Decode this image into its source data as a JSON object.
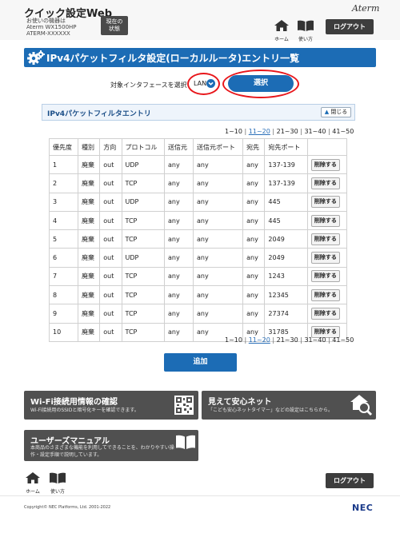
{
  "header": {
    "app_title": "クイック設定Web",
    "device_caption": "お使いの機器は",
    "device_model": "Aterm WX1500HP",
    "device_name": "ATERM-XXXXXX",
    "status_button_line1": "現在の",
    "status_button_line2": "状態",
    "brand": "Aterm",
    "home_label": "ホーム",
    "manual_label": "使い方",
    "logout_label": "ログアウト"
  },
  "page": {
    "title": "IPv4パケットフィルタ設定(ローカルルータ)エントリ一覧",
    "interface_label": "対象インタフェースを選択",
    "interface_value": "LAN",
    "select_button": "選択",
    "panel_title": "IPv4パケットフィルタエントリ",
    "collapse_label": "閉じる",
    "add_button": "追加"
  },
  "pager": {
    "pages": [
      "1~10",
      "11~20",
      "21~30",
      "31~40",
      "41~50"
    ],
    "current_index": 1
  },
  "table": {
    "headers": [
      "優先度",
      "種別",
      "方向",
      "プロトコル",
      "送信元",
      "送信元ポート",
      "宛先",
      "宛先ポート"
    ],
    "delete_label": "削除する",
    "rows": [
      [
        "1",
        "廃棄",
        "out",
        "UDP",
        "any",
        "any",
        "any",
        "137-139"
      ],
      [
        "2",
        "廃棄",
        "out",
        "TCP",
        "any",
        "any",
        "any",
        "137-139"
      ],
      [
        "3",
        "廃棄",
        "out",
        "UDP",
        "any",
        "any",
        "any",
        "445"
      ],
      [
        "4",
        "廃棄",
        "out",
        "TCP",
        "any",
        "any",
        "any",
        "445"
      ],
      [
        "5",
        "廃棄",
        "out",
        "TCP",
        "any",
        "any",
        "any",
        "2049"
      ],
      [
        "6",
        "廃棄",
        "out",
        "UDP",
        "any",
        "any",
        "any",
        "2049"
      ],
      [
        "7",
        "廃棄",
        "out",
        "TCP",
        "any",
        "any",
        "any",
        "1243"
      ],
      [
        "8",
        "廃棄",
        "out",
        "TCP",
        "any",
        "any",
        "any",
        "12345"
      ],
      [
        "9",
        "廃棄",
        "out",
        "TCP",
        "any",
        "any",
        "any",
        "27374"
      ],
      [
        "10",
        "廃棄",
        "out",
        "TCP",
        "any",
        "any",
        "any",
        "31785"
      ]
    ]
  },
  "cards": {
    "wifi_title": "Wi-Fi接続用情報の確認",
    "wifi_desc": "Wi-Fi接続用のSSIDと暗号化キーを確認できます。",
    "safe_title": "見えて安心ネット",
    "safe_desc": "「こども安心ネットタイマー」などの設定はこちらから。",
    "manual_title": "ユーザーズマニュアル",
    "manual_desc_line1": "本商品のさまざまな機能を利用してできることを、わかりやすい操",
    "manual_desc_line2": "作・設定手順で説明しています。"
  },
  "footer": {
    "home_label": "ホーム",
    "manual_label": "使い方",
    "logout_label": "ログアウト",
    "copyright": "Copyright© NEC Platforms, Ltd. 2001-2022",
    "nec_logo": "NEC"
  },
  "colors": {
    "accent_blue": "#1c6cb5",
    "highlight_red": "#e8161b",
    "dark_button": "#3d3d3d",
    "card_gray": "#505050"
  },
  "icons": [
    "gear-icon",
    "home-icon",
    "book-icon",
    "chevron-down-icon",
    "triangle-up-icon",
    "qr-code-icon",
    "house-magnifier-icon"
  ]
}
